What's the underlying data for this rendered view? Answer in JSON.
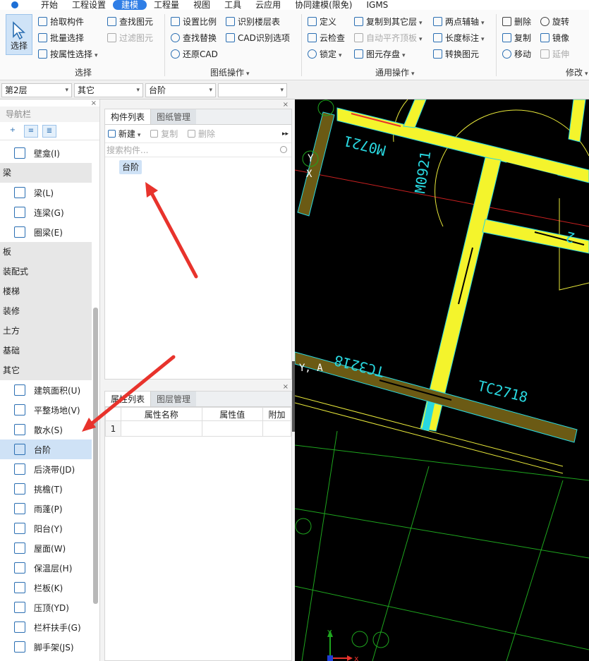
{
  "menu": {
    "tabs": [
      "开始",
      "工程设置",
      "建模",
      "工程量",
      "视图",
      "工具",
      "云应用",
      "协同建模(限免)",
      "IGMS"
    ],
    "active_tab": "建模"
  },
  "ribbon": {
    "select_big": "选择",
    "select_group": {
      "pick": "拾取构件",
      "batch": "批量选择",
      "by_attr": "按属性选择",
      "title": "选择"
    },
    "find_group": {
      "find": "查找图元",
      "filter": "过滤图元"
    },
    "drawing_group": {
      "scale": "设置比例",
      "find_replace": "查找替换",
      "restore_cad": "还原CAD",
      "identify_floor": "识别楼层表",
      "cad_options": "CAD识别选项",
      "title": "图纸操作"
    },
    "common_group": {
      "define": "定义",
      "cloud_check": "云检查",
      "lock": "锁定",
      "copy_floor": "复制到其它层",
      "auto_level": "自动平齐顶板",
      "save": "图元存盘",
      "two_point": "两点辅轴",
      "length_dim": "长度标注",
      "convert": "转换图元",
      "title": "通用操作"
    },
    "modify_group": {
      "delete": "删除",
      "copy": "复制",
      "move": "移动",
      "rotate": "旋转",
      "mirror": "镜像",
      "extend": "延伸",
      "title": "修改"
    }
  },
  "combos": {
    "floor": "第2层",
    "type": "其它",
    "component": "台阶",
    "sub": ""
  },
  "nav": {
    "title": "导航栏",
    "close": "×",
    "items": [
      {
        "kind": "item",
        "label": "壁龛(I)"
      },
      {
        "kind": "cat",
        "label": "梁"
      },
      {
        "kind": "item",
        "label": "梁(L)"
      },
      {
        "kind": "item",
        "label": "连梁(G)"
      },
      {
        "kind": "item",
        "label": "圈梁(E)"
      },
      {
        "kind": "cat",
        "label": "板"
      },
      {
        "kind": "cat",
        "label": "装配式"
      },
      {
        "kind": "cat",
        "label": "楼梯"
      },
      {
        "kind": "cat",
        "label": "装修"
      },
      {
        "kind": "cat",
        "label": "土方"
      },
      {
        "kind": "cat",
        "label": "基础"
      },
      {
        "kind": "cat",
        "label": "其它"
      },
      {
        "kind": "item",
        "label": "建筑面积(U)"
      },
      {
        "kind": "item",
        "label": "平整场地(V)"
      },
      {
        "kind": "item",
        "label": "散水(S)"
      },
      {
        "kind": "item",
        "label": "台阶",
        "selected": true
      },
      {
        "kind": "item",
        "label": "后浇带(JD)"
      },
      {
        "kind": "item",
        "label": "挑檐(T)"
      },
      {
        "kind": "item",
        "label": "雨蓬(P)"
      },
      {
        "kind": "item",
        "label": "阳台(Y)"
      },
      {
        "kind": "item",
        "label": "屋面(W)"
      },
      {
        "kind": "item",
        "label": "保温层(H)"
      },
      {
        "kind": "item",
        "label": "栏板(K)"
      },
      {
        "kind": "item",
        "label": "压顶(YD)"
      },
      {
        "kind": "item",
        "label": "栏杆扶手(G)"
      },
      {
        "kind": "item",
        "label": "脚手架(JS)"
      }
    ]
  },
  "component_panel": {
    "tab_active": "构件列表",
    "tab_inactive": "图纸管理",
    "new": "新建",
    "copy": "复制",
    "delete": "删除",
    "search_placeholder": "搜索构件...",
    "item": "台阶"
  },
  "property_panel": {
    "tab_active": "属性列表",
    "tab_inactive": "图层管理",
    "col_name": "属性名称",
    "col_value": "属性值",
    "col_extra": "附加",
    "row1": "1"
  },
  "cad": {
    "labels": [
      "M0721",
      "M0921",
      "TC3218",
      "TC2718",
      "2"
    ],
    "axis_marks": [
      "Y",
      "X",
      "Y, A"
    ],
    "coord": {
      "x": "x",
      "y": "Y"
    },
    "colors": {
      "wall": "#6b5a14",
      "wall_yellow": "#f4f42c",
      "outline": "#29d8e0",
      "grid": "#1ea51e",
      "arrow_red": "#e8332c"
    }
  }
}
